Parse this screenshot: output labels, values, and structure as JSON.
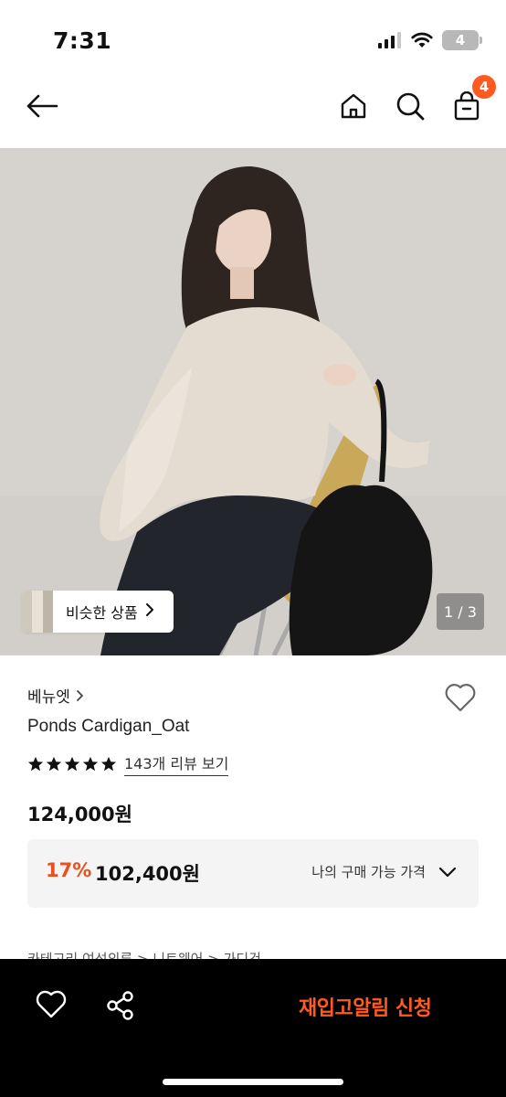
{
  "status_bar": {
    "time": "7:31",
    "battery": "4",
    "icons": [
      "signal-icon",
      "wifi-icon",
      "battery-icon"
    ]
  },
  "nav": {
    "icons": [
      "back-arrow-icon",
      "home-icon",
      "search-icon",
      "cart-icon"
    ],
    "cart_count": "4"
  },
  "gallery": {
    "similar_label": "비슷한 상품",
    "page_indicator": "1 / 3"
  },
  "product": {
    "brand": "베뉴엣",
    "name": "Ponds Cardigan_Oat",
    "rating_stars": 5,
    "review_link": "143개 리뷰 보기",
    "original_price": "124,000원",
    "discount_percent": "17%",
    "final_price": "102,400원",
    "price_toggle_label": "나의 구매 가능 가격"
  },
  "category_peek": "카테고리   여성의류 > 니트웨어 > 가디건",
  "bottom_bar": {
    "icons": [
      "heart-icon",
      "share-icon"
    ],
    "restock_label": "재입고알림 신청"
  },
  "colors": {
    "accent": "#ff5a1f",
    "discount": "#e8501f",
    "price_box_bg": "#f4f4f4"
  }
}
